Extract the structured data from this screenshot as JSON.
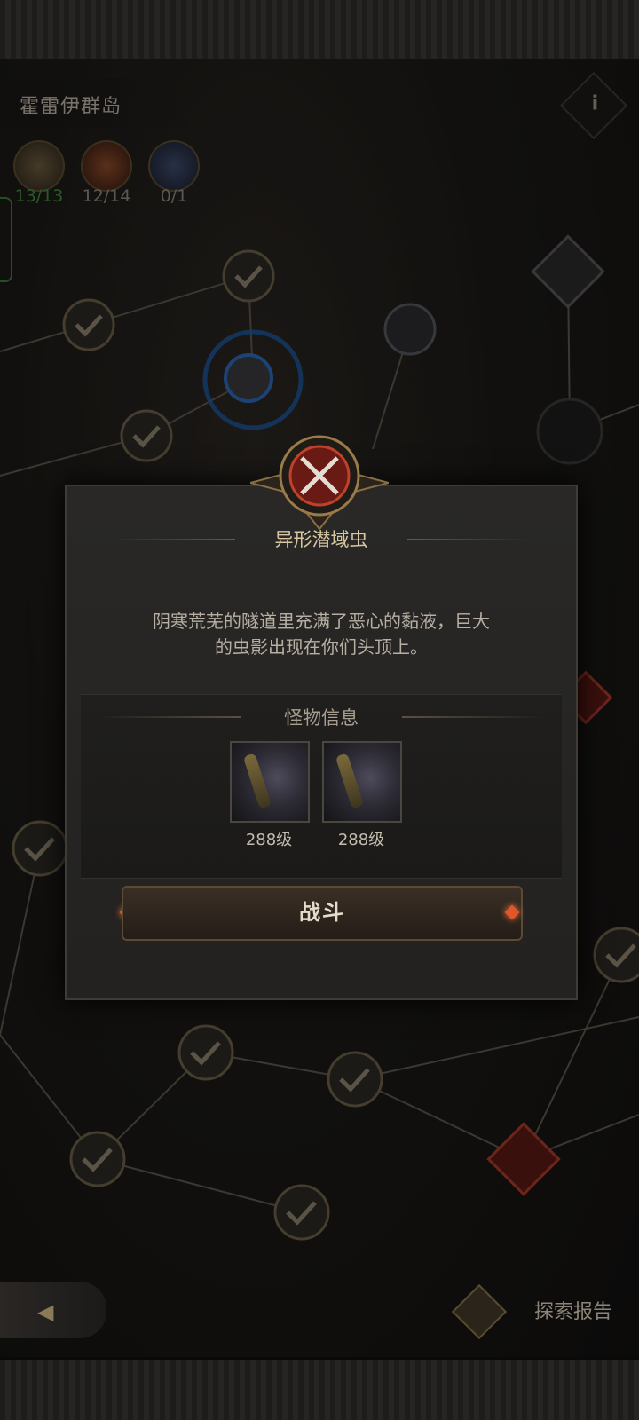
{
  "header": {
    "region_name": "霍雷伊群岛",
    "info_icon": "info-icon"
  },
  "counters": [
    {
      "icon": "chest-icon",
      "value": "13/13",
      "color": "#3e8a3c"
    },
    {
      "icon": "red-chest-icon",
      "value": "12/14",
      "color": "#8f877a"
    },
    {
      "icon": "boss-chest-icon",
      "value": "0/1",
      "color": "#8f877a"
    }
  ],
  "dialog": {
    "emblem_icon": "crossed-swords-icon",
    "title": "异形潜域虫",
    "description_line1": "阴寒荒芜的隧道里充满了恶心的黏液，巨大",
    "description_line2": "的虫影出现在你们头顶上。",
    "monster_section_title": "怪物信息",
    "monsters": [
      {
        "portrait_icon": "worm-monster-icon",
        "level": "288级"
      },
      {
        "portrait_icon": "worm-monster-icon",
        "level": "288级"
      }
    ],
    "fight_label": "战斗",
    "accent_color": "#e2562a"
  },
  "footer": {
    "back_icon": "back-arrow-icon",
    "report_icon": "scroll-icon",
    "report_label": "探索报告"
  }
}
